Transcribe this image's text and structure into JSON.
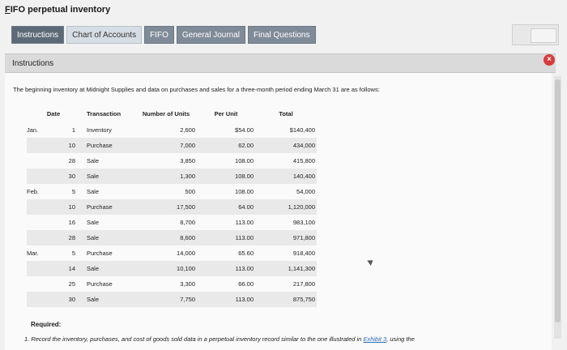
{
  "app": {
    "title_first": "F",
    "title_rest": "IFO perpetual inventory"
  },
  "tabs": [
    {
      "label": "Instructions"
    },
    {
      "label": "Chart of Accounts"
    },
    {
      "label": "FIFO"
    },
    {
      "label": "General Journal"
    },
    {
      "label": "Final Questions"
    }
  ],
  "panel": {
    "label": "Instructions",
    "close_glyph": "×"
  },
  "intro": "The beginning inventory at Midnight Supplies and data on purchases and sales for a three-month period ending March 31 are as follows:",
  "table": {
    "headers": [
      "Date",
      "Transaction",
      "Number of Units",
      "Per Unit",
      "Total"
    ],
    "rows": [
      {
        "month": "Jan.",
        "day": "1",
        "type": "Inventory",
        "units": "2,600",
        "cost": "$54.00",
        "total": "$140,400"
      },
      {
        "month": "",
        "day": "10",
        "type": "Purchase",
        "units": "7,000",
        "cost": "62.00",
        "total": "434,000"
      },
      {
        "month": "",
        "day": "28",
        "type": "Sale",
        "units": "3,850",
        "cost": "108.00",
        "total": "415,800"
      },
      {
        "month": "",
        "day": "30",
        "type": "Sale",
        "units": "1,300",
        "cost": "108.00",
        "total": "140,400"
      },
      {
        "month": "Feb.",
        "day": "5",
        "type": "Sale",
        "units": "500",
        "cost": "108.00",
        "total": "54,000"
      },
      {
        "month": "",
        "day": "10",
        "type": "Purchase",
        "units": "17,500",
        "cost": "64.00",
        "total": "1,120,000"
      },
      {
        "month": "",
        "day": "16",
        "type": "Sale",
        "units": "8,700",
        "cost": "113.00",
        "total": "983,100"
      },
      {
        "month": "",
        "day": "28",
        "type": "Sale",
        "units": "8,600",
        "cost": "113.00",
        "total": "971,800"
      },
      {
        "month": "Mar.",
        "day": "5",
        "type": "Purchase",
        "units": "14,000",
        "cost": "65.60",
        "total": "918,400"
      },
      {
        "month": "",
        "day": "14",
        "type": "Sale",
        "units": "10,100",
        "cost": "113.00",
        "total": "1,141,300"
      },
      {
        "month": "",
        "day": "25",
        "type": "Purchase",
        "units": "3,300",
        "cost": "66.00",
        "total": "217,800"
      },
      {
        "month": "",
        "day": "30",
        "type": "Sale",
        "units": "7,750",
        "cost": "113.00",
        "total": "875,750"
      }
    ]
  },
  "required": {
    "heading": "Required:",
    "line_prefix": "1. Record the inventory, purchases, and cost of goods sold data in a perpetual inventory record similar to the one illustrated in ",
    "link": "Exhibit 3",
    "line_suffix": ", using the"
  }
}
